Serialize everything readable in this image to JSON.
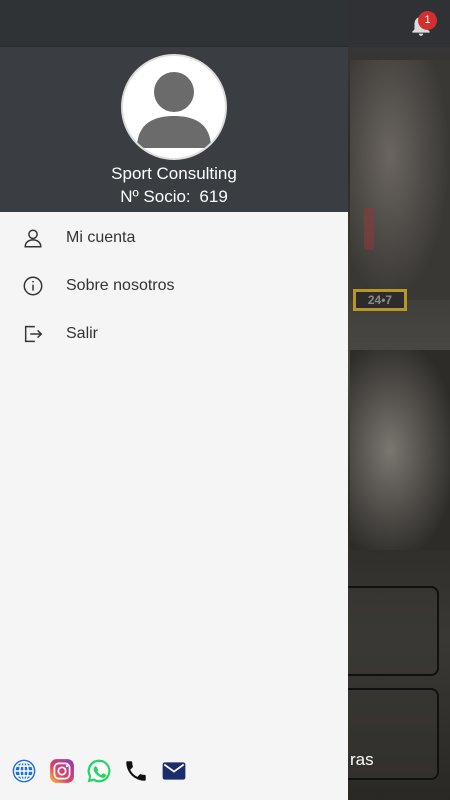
{
  "background": {
    "sign_text": "24•7",
    "notification_count": "1",
    "card_label": "ras"
  },
  "profile": {
    "name": "Sport Consulting",
    "member_label": "Nº Socio:",
    "member_number": "619"
  },
  "menu": {
    "items": [
      {
        "label": "Mi cuenta",
        "icon": "user-icon"
      },
      {
        "label": "Sobre nosotros",
        "icon": "info-icon"
      },
      {
        "label": "Salir",
        "icon": "logout-icon"
      }
    ]
  },
  "social": {
    "icons": [
      "globe-icon",
      "instagram-icon",
      "whatsapp-icon",
      "phone-icon",
      "mail-icon"
    ]
  },
  "colors": {
    "drawer_header": "#3a3e42",
    "drawer_body": "#f5f5f5",
    "badge": "#d32f2f"
  }
}
